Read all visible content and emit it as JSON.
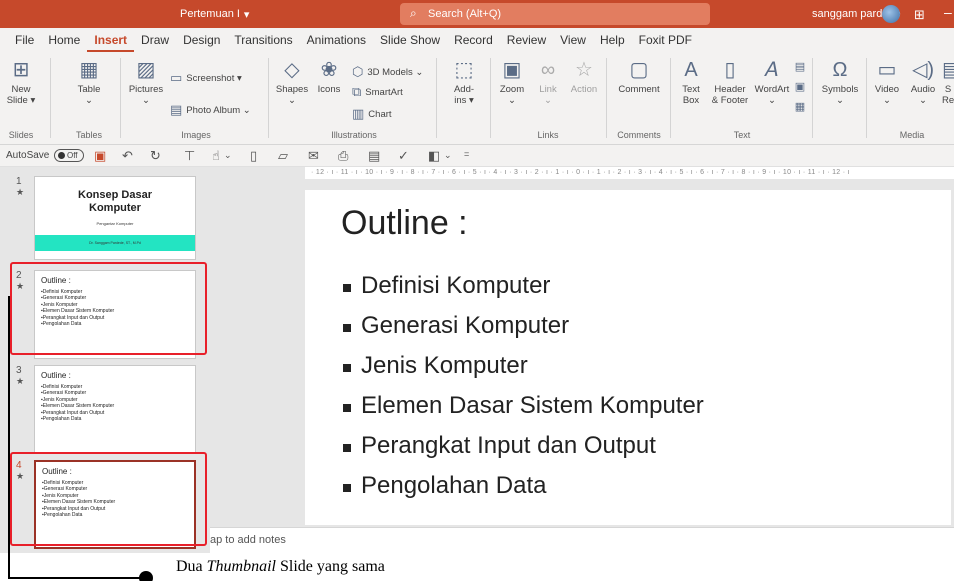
{
  "titlebar": {
    "doc_title": "Pertemuan I",
    "doc_title_caret": "▾",
    "search_placeholder": "Search (Alt+Q)",
    "user_name": "sanggam pardede",
    "accent": "#c6492b"
  },
  "menu": {
    "tabs": [
      "File",
      "Home",
      "Insert",
      "Draw",
      "Design",
      "Transitions",
      "Animations",
      "Slide Show",
      "Record",
      "Review",
      "View",
      "Help",
      "Foxit PDF"
    ],
    "active_tab": "Insert"
  },
  "ribbon": {
    "slides": {
      "new_slide_line1": "New",
      "new_slide_line2": "Slide ▾",
      "group": "Slides"
    },
    "tables": {
      "table": "Table",
      "table_caret": "⌄",
      "group": "Tables"
    },
    "images": {
      "pictures": "Pictures",
      "pictures_caret": "⌄",
      "screenshot": "Screenshot ▾",
      "photo_album": "Photo Album ⌄",
      "group": "Images"
    },
    "illustrations": {
      "shapes": "Shapes",
      "shapes_caret": "⌄",
      "icons": "Icons",
      "models3d": "3D Models ⌄",
      "smartart": "SmartArt",
      "chart": "Chart",
      "group": "Illustrations"
    },
    "addins": {
      "line1": "Add-",
      "line2": "ins ▾"
    },
    "links": {
      "zoom": "Zoom",
      "zoom_caret": "⌄",
      "link": "Link",
      "link_caret": "⌄",
      "action": "Action",
      "group": "Links"
    },
    "comments": {
      "comment": "Comment",
      "group": "Comments"
    },
    "text": {
      "textbox_line1": "Text",
      "textbox_line2": "Box",
      "header_line1": "Header",
      "header_line2": "& Footer",
      "wordart": "WordArt",
      "wordart_caret": "⌄",
      "group": "Text"
    },
    "symbols": {
      "symbols": "Symbols",
      "symbols_caret": "⌄"
    },
    "media": {
      "video": "Video",
      "video_caret": "⌄",
      "audio": "Audio",
      "audio_caret": "⌄",
      "screen_rec_partial": "S",
      "screen_rec_partial2": "Re",
      "group": "Media"
    }
  },
  "qat": {
    "autosave": "AutoSave",
    "autosave_state": "Off"
  },
  "ruler": {
    "horizontal": "· 12 · ı · 11 · ı · 10 · ı · 9 · ı · 8 · ı · 7 · ı · 6 · ı · 5 · ı · 4 · ı · 3 · ı · 2 · ı · 1 · ı · 0 · ı · 1 · ı · 2 · ı · 3 · ı · 4 · ı · 5 · ı · 6 · ı · 7 · ı · 8 · ı · 9 · ı · 10 · ı · 11 · ı · 12 · ı"
  },
  "slides": [
    {
      "number": "1",
      "title_line1": "Konsep Dasar",
      "title_line2": "Komputer",
      "subtitle": "Pengantar Komputer",
      "footer": "Dr. Sanggam Pardede, ST., M.Pd"
    },
    {
      "number": "2",
      "title": "Outline :",
      "items": [
        "Definisi Komputer",
        "Generasi Komputer",
        "Jenis Komputer",
        "Elemen Dasar Sistem Komputer",
        "Perangkat Input dan Output",
        "Pengolahan Data"
      ]
    },
    {
      "number": "3",
      "title": "Outline :",
      "items": [
        "Definisi Komputer",
        "Generasi Komputer",
        "Jenis Komputer",
        "Elemen Dasar Sistem Komputer",
        "Perangkat Input dan Output",
        "Pengolahan Data"
      ]
    },
    {
      "number": "4",
      "title": "Outline :",
      "items": [
        "Definisi Komputer",
        "Generasi Komputer",
        "Jenis Komputer",
        "Elemen Dasar Sistem Komputer",
        "Perangkat Input dan Output",
        "Pengolahan Data"
      ]
    }
  ],
  "main_slide": {
    "title": "Outline :",
    "items": [
      "Definisi Komputer",
      "Generasi Komputer",
      "Jenis Komputer",
      "Elemen Dasar Sistem Komputer",
      "Perangkat Input dan Output",
      "Pengolahan Data"
    ]
  },
  "notes_placeholder": "ap to add notes",
  "annotation": {
    "prefix": "Dua ",
    "italic": "Thumbnail",
    "suffix": " Slide yang sama",
    "box_color": "#e8202a"
  }
}
